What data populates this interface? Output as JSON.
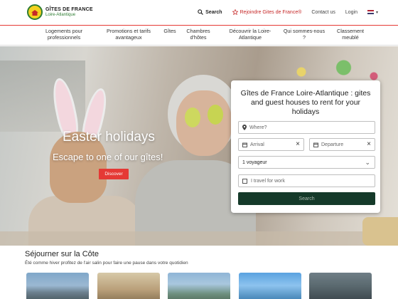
{
  "header": {
    "logo": {
      "title": "GÎTES DE FRANCE",
      "subtitle": "Loire-Atlantique",
      "icon": "gites-de-france-logo"
    },
    "links": [
      {
        "label": "Search",
        "icon": "search-icon"
      },
      {
        "label": "Rejoindre Gites de France®",
        "icon": "star-icon"
      },
      {
        "label": "Contact us"
      },
      {
        "label": "Login"
      }
    ],
    "language": {
      "icon": "flag-uk-icon",
      "caret": "▾"
    }
  },
  "nav": {
    "items": [
      {
        "label": "Logements pour professionnels"
      },
      {
        "label": "Promotions et tarifs avantageux"
      },
      {
        "label": "Gîtes"
      },
      {
        "label": "Chambres d'hôtes"
      },
      {
        "label": "Découvrir la Loire-Atlantique"
      },
      {
        "label": "Qui sommes-nous ?"
      },
      {
        "label": "Classement meublé"
      }
    ]
  },
  "hero": {
    "title": "Easter holidays",
    "subtitle": "Escape to one of our gîtes!",
    "button_label": "Discover"
  },
  "search_panel": {
    "title": "Gîtes de France Loire-Atlantique : gites and guest houses to rent for your holidays",
    "where_placeholder": "Where?",
    "arrival_placeholder": "Arrival",
    "departure_placeholder": "Departure",
    "travellers_value": "1 voyageur",
    "work_label": "I travel for work",
    "search_label": "Search"
  },
  "section": {
    "title": "Séjourner sur la Côte",
    "subtitle": "Été comme hiver profitez de l'air salin pour faire une pause dans votre quotidien"
  },
  "colors": {
    "accent_red": "#e53935",
    "dark_green": "#153a2a",
    "logo_green": "#2e7d32",
    "logo_yellow": "#f4d21f"
  }
}
